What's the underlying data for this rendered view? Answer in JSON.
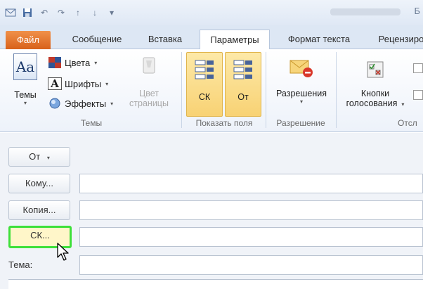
{
  "window": {
    "title": "Б"
  },
  "tabs": [
    {
      "label": "Файл"
    },
    {
      "label": "Сообщение"
    },
    {
      "label": "Вставка"
    },
    {
      "label": "Параметры"
    },
    {
      "label": "Формат текста"
    },
    {
      "label": "Рецензиро"
    }
  ],
  "ribbon": {
    "themes": {
      "themes_label": "Темы",
      "colors_label": "Цвета",
      "fonts_label": "Шрифты",
      "effects_label": "Эффекты",
      "page_color_line1": "Цвет",
      "page_color_line2": "страницы",
      "group_label": "Темы"
    },
    "show_fields": {
      "bcc_label": "СК",
      "from_label": "От",
      "group_label": "Показать поля"
    },
    "permission": {
      "permission_label": "Разрешения",
      "group_label": "Разрешение"
    },
    "tracking": {
      "voting_line1": "Кнопки",
      "voting_line2": "голосования",
      "group_label": "Отсл"
    }
  },
  "form": {
    "from_button": "От",
    "to_button": "Кому...",
    "cc_button": "Копия...",
    "bcc_button": "СК...",
    "subject_label": "Тема:"
  },
  "colors": {
    "file_tab": "#e87a2f",
    "highlight": "#f8d274",
    "glow": "#3ee03a"
  }
}
